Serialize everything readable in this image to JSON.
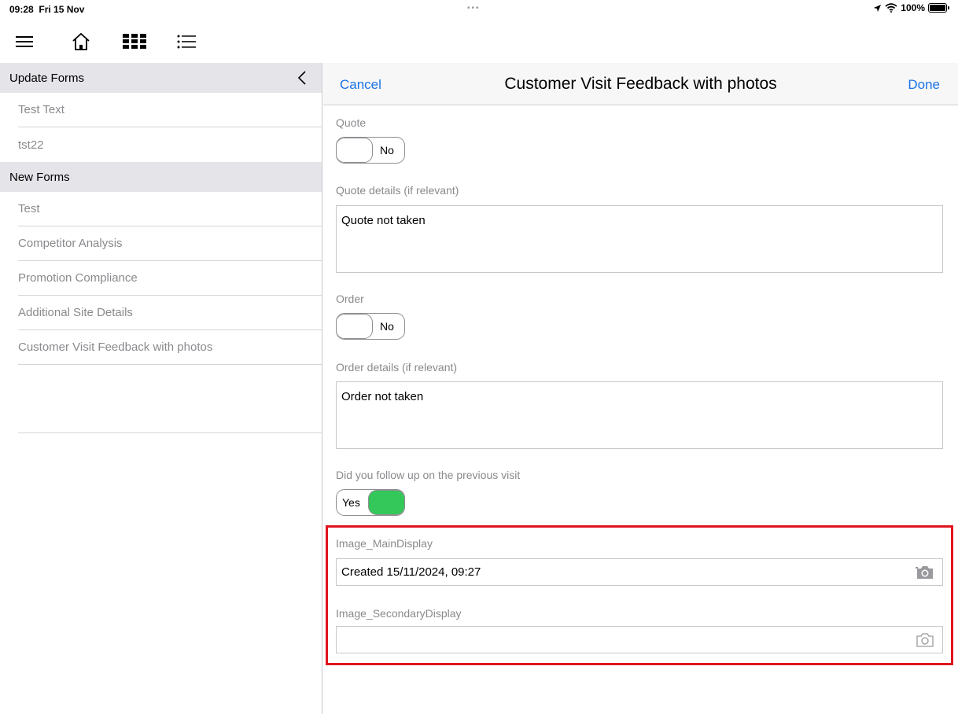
{
  "status_bar": {
    "time": "09:28",
    "date": "Fri 15 Nov",
    "dots": "•••",
    "battery": "100%"
  },
  "toolbar": {
    "icons": [
      "menu-icon",
      "home-icon",
      "grid-icon",
      "list-icon"
    ]
  },
  "sidebar": {
    "sections": [
      {
        "title": "Update Forms",
        "items": [
          "Test Text",
          "tst22"
        ]
      },
      {
        "title": "New Forms",
        "items": [
          "Test",
          "Competitor Analysis",
          "Promotion Compliance",
          "Additional Site Details",
          "Customer Visit Feedback with photos"
        ]
      }
    ]
  },
  "form": {
    "cancel_label": "Cancel",
    "title": "Customer Visit Feedback with photos",
    "done_label": "Done",
    "fields": {
      "quote": {
        "label": "Quote",
        "value": "No"
      },
      "quote_details": {
        "label": "Quote details (if relevant)",
        "value": "Quote not taken"
      },
      "order": {
        "label": "Order",
        "value": "No"
      },
      "order_details": {
        "label": "Order details (if relevant)",
        "value": "Order not taken"
      },
      "follow_up": {
        "label": "Did you follow up on the previous visit",
        "value": "Yes"
      },
      "image_main": {
        "label": "Image_MainDisplay",
        "value": "Created 15/11/2024, 09:27"
      },
      "image_secondary": {
        "label": "Image_SecondaryDisplay",
        "value": ""
      }
    }
  },
  "colors": {
    "accent": "#1a73e8",
    "toggle_on": "#34c759",
    "highlight": "#e0141e",
    "section_bg": "#e4e4e9"
  }
}
